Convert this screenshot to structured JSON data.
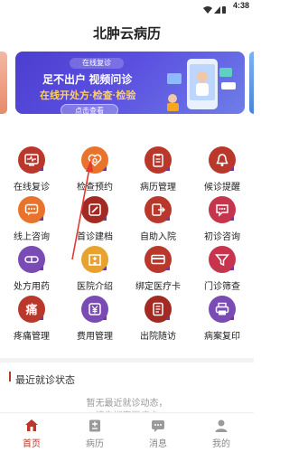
{
  "status": {
    "time": "4:38"
  },
  "app": {
    "title": "北肿云病历"
  },
  "banner": {
    "tag": "在线复诊",
    "line1": "足不出户 视频问诊",
    "line2": "在线开处方·检查·检验",
    "button": "点击查看"
  },
  "menu": [
    {
      "label": "在线复诊",
      "icon": "monitor-icon",
      "color": "#b9372b"
    },
    {
      "label": "检查预约",
      "icon": "heart-search-icon",
      "color": "#e9732a"
    },
    {
      "label": "病历管理",
      "icon": "clipboard-icon",
      "color": "#b9372b"
    },
    {
      "label": "候诊提醒",
      "icon": "bell-icon",
      "color": "#b9372b"
    },
    {
      "label": "线上咨询",
      "icon": "chat-icon",
      "color": "#e9732a"
    },
    {
      "label": "首诊建档",
      "icon": "pen-icon",
      "color": "#a32a22"
    },
    {
      "label": "自助入院",
      "icon": "document-exit-icon",
      "color": "#b9372b"
    },
    {
      "label": "初诊咨询",
      "icon": "speech-icon",
      "color": "#c6354d"
    },
    {
      "label": "处方用药",
      "icon": "pill-icon",
      "color": "#7a4bb4"
    },
    {
      "label": "医院介绍",
      "icon": "building-icon",
      "color": "#e7a22f"
    },
    {
      "label": "绑定医疗卡",
      "icon": "card-icon",
      "color": "#b9372b"
    },
    {
      "label": "门诊筛查",
      "icon": "filter-icon",
      "color": "#c6354d"
    },
    {
      "label": "疼痛管理",
      "icon": "pain-icon",
      "color": "#b9372b"
    },
    {
      "label": "费用管理",
      "icon": "yen-icon",
      "color": "#7a4bb4"
    },
    {
      "label": "出院随访",
      "icon": "notes-icon",
      "color": "#a32a22"
    },
    {
      "label": "病案复印",
      "icon": "printer-icon",
      "color": "#7a4bb4"
    }
  ],
  "recent": {
    "title": "最近就诊状态",
    "empty_line1": "暂无最近就诊动态，",
    "empty_line2": "请先绑定医疗卡"
  },
  "tabs": [
    {
      "label": "首页",
      "icon": "home-icon",
      "active": true
    },
    {
      "label": "病历",
      "icon": "record-icon",
      "active": false
    },
    {
      "label": "消息",
      "icon": "message-icon",
      "active": false
    },
    {
      "label": "我的",
      "icon": "profile-icon",
      "active": false
    }
  ],
  "colors": {
    "accent": "#b9372b",
    "banner_bg": "#5246d8",
    "banner_highlight": "#ffd25a"
  }
}
